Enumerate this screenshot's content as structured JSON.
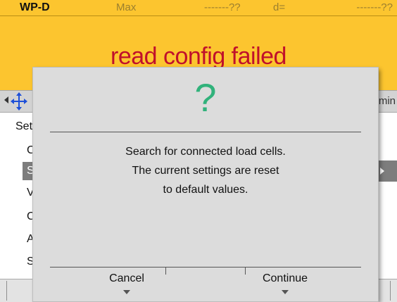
{
  "status_bar": {
    "device_name": "WP-D",
    "max_label": "Max",
    "max_value": "-------??",
    "d_label": "d=",
    "d_value": "-------??"
  },
  "header": {
    "message": "read config failed"
  },
  "nav": {
    "right_text": "min"
  },
  "menu": {
    "title": "Set",
    "items": [
      "C",
      "S",
      "V",
      "C",
      "A",
      "S"
    ],
    "selected_index": 1
  },
  "dialog": {
    "icon": "question-mark",
    "icon_glyph": "?",
    "message_lines": [
      "Search for connected load cells.",
      "The current settings are reset",
      "to default values."
    ],
    "buttons": {
      "cancel": "Cancel",
      "continue": "Continue"
    }
  },
  "colors": {
    "header_yellow": "#fcc52f",
    "error_red": "#c0102b",
    "question_green": "#31b27b",
    "dialog_gray": "#dcdcdc",
    "selection_gray": "#7d7d7d"
  }
}
